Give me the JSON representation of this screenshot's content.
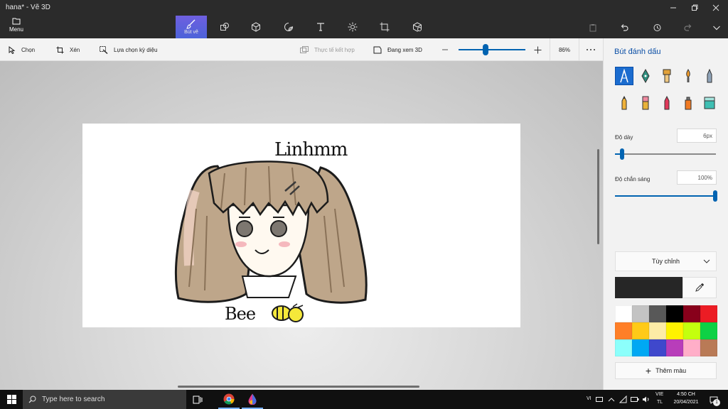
{
  "window": {
    "title": "hana* - Vẽ 3D"
  },
  "menu": {
    "label": "Menu"
  },
  "ribbon": {
    "tabs": [
      {
        "name": "brushes",
        "label": "Bút vẽ",
        "icon": "brush-icon",
        "active": true
      },
      {
        "name": "2d-shapes",
        "label": "",
        "icon": "2d-shapes-icon"
      },
      {
        "name": "3d-shapes",
        "label": "",
        "icon": "3d-cube-icon"
      },
      {
        "name": "stickers",
        "label": "",
        "icon": "sticker-icon"
      },
      {
        "name": "text",
        "label": "",
        "icon": "text-icon"
      },
      {
        "name": "effects",
        "label": "",
        "icon": "effects-icon"
      },
      {
        "name": "canvas",
        "label": "",
        "icon": "crop-canvas-icon"
      },
      {
        "name": "3d-library",
        "label": "",
        "icon": "3d-library-icon"
      }
    ]
  },
  "toolbar": {
    "select": "Chọn",
    "crop": "Xén",
    "magic_select": "Lựa chọn kỳ diệu",
    "mixed_reality": "Thực tế kết hợp",
    "view_3d": "Đang xem 3D",
    "zoom_value": "86%",
    "zoom_fraction": 0.4
  },
  "canvas": {
    "text_top": "Linhmm",
    "text_bottom": "Bee"
  },
  "panel": {
    "title": "Bút đánh dấu",
    "thickness_label": "Độ dày",
    "thickness_value": "6px",
    "opacity_label": "Độ chắn sáng",
    "opacity_value": "100%",
    "custom_label": "Tùy chỉnh",
    "add_color_label": "Thêm màu",
    "current_color": "#262626",
    "swatches": [
      "#ffffff",
      "#c3c3c3",
      "#585858",
      "#000000",
      "#88001b",
      "#ec1c24",
      "#ff7f27",
      "#ffca18",
      "#fdeca6",
      "#fff200",
      "#c4ff0e",
      "#0ed145",
      "#8cfffb",
      "#00a8f3",
      "#3f48cc",
      "#b83dba",
      "#ffaec8",
      "#b97a56"
    ]
  },
  "taskbar": {
    "search_placeholder": "Type here to search",
    "tray_lang": "VI",
    "input_lang_top": "VIE",
    "input_lang_bottom": "TL",
    "time": "4:50 CH",
    "date": "20/04/2021",
    "notifications": "1"
  }
}
